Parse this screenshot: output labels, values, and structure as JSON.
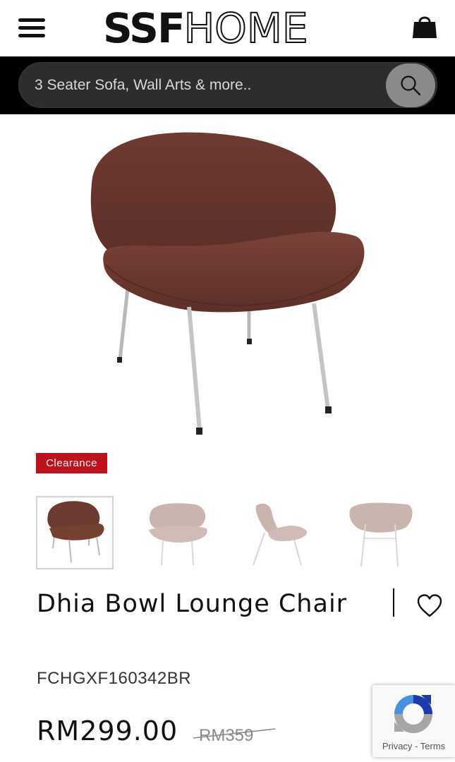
{
  "header": {
    "logo_bold": "SSF",
    "logo_outline": "HOME",
    "menu_icon": "hamburger-menu-icon",
    "cart_icon": "shopping-bag-icon"
  },
  "search": {
    "placeholder": "3 Seater Sofa, Wall Arts & more..",
    "button_icon": "search-icon"
  },
  "product": {
    "badge": "Clearance",
    "title": "Dhia Bowl Lounge Chair",
    "sku": "FCHGXF160342BR",
    "price": "RM299.00",
    "original_price": "RM359",
    "wishlist_icon": "heart-outline-icon",
    "thumbnails": [
      {
        "label": "front-view",
        "selected": true
      },
      {
        "label": "front-view-faded",
        "selected": false
      },
      {
        "label": "side-view-faded",
        "selected": false
      },
      {
        "label": "back-view-faded",
        "selected": false
      }
    ]
  },
  "recaptcha": {
    "privacy": "Privacy",
    "separator": "-",
    "terms": "Terms"
  },
  "colors": {
    "brand_black": "#000000",
    "badge_red": "#c0101a",
    "chair_brown": "#6b3a30",
    "search_button": "#8a8a8a"
  }
}
